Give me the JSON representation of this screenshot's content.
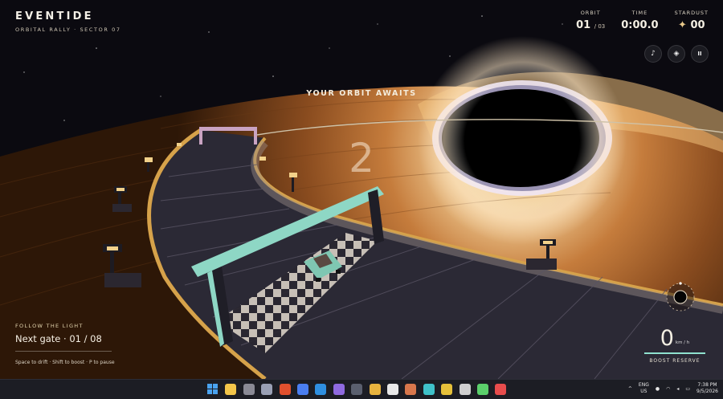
{
  "game": {
    "title": "EVENTIDE",
    "subtitle": "ORBITAL RALLY · SECTOR 07"
  },
  "stats": {
    "orbit_label": "ORBIT",
    "orbit_value": "01",
    "orbit_total": "/ 03",
    "time_label": "TIME",
    "time_value": "0:00.0",
    "stardust_label": "STARDUST",
    "stardust_symbol": "✦",
    "stardust_value": "00"
  },
  "controls": {
    "music_icon": "♪",
    "camera_icon": "◈",
    "pause_icon": "II"
  },
  "prompt": "YOUR ORBIT AWAITS",
  "countdown": "2",
  "objective": {
    "kicker": "FOLLOW THE LIGHT",
    "gate_text": "Next gate · 01 / 08",
    "hint": "Space to drift · Shift to boost · P to pause"
  },
  "speed": {
    "value": "0",
    "unit": "km / h",
    "boost_label": "BOOST RESERVE",
    "boost_level": 1.0
  },
  "taskbar": {
    "language_top": "ENG",
    "language_bottom": "US",
    "time": "7:38 PM",
    "date": "9/5/2026",
    "apps": [
      "windows-start-icon",
      "file-explorer-icon",
      "github-icon",
      "box-3d-icon",
      "brave-browser-icon",
      "maps-pin-icon",
      "vscode-icon",
      "obsidian-icon",
      "window-app-icon",
      "photos-icon",
      "notion-icon",
      "claude-icon",
      "edit-app-icon",
      "chrome-icon",
      "chatgpt-icon",
      "puzzle-app-icon",
      "pdf-app-icon"
    ]
  },
  "colors": {
    "track_rim": "#d6a24a",
    "gate_color": "#8ed7c5",
    "boost_bar": "#8fe2cf"
  }
}
